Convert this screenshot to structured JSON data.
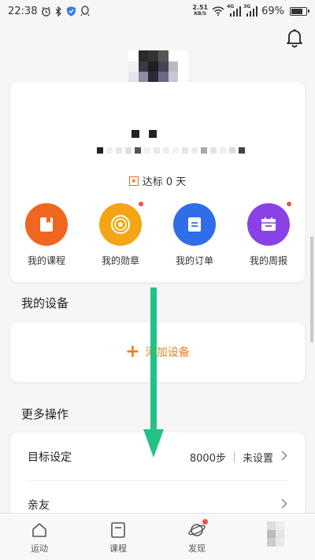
{
  "status_bar": {
    "time": "22:38",
    "net_speed_value": "2.51",
    "net_speed_unit": "KB/S",
    "battery": "69%",
    "signal_1": "4G",
    "signal_2": "3G"
  },
  "header": {
    "notification_icon": "bell-icon"
  },
  "profile": {
    "goal_badge": "★",
    "goal_text": "达标 0 天"
  },
  "quick_actions": [
    {
      "label": "我的课程",
      "color": "#f0661e",
      "icon": "book-icon",
      "dot": false
    },
    {
      "label": "我的勋章",
      "color": "#f4a515",
      "icon": "medal-icon",
      "dot": true
    },
    {
      "label": "我的订单",
      "color": "#2f6ee8",
      "icon": "document-icon",
      "dot": false
    },
    {
      "label": "我的周报",
      "color": "#8a42e6",
      "icon": "report-icon",
      "dot": true
    }
  ],
  "devices": {
    "title": "我的设备",
    "add_plus": "+",
    "add_label": "添加设备"
  },
  "more": {
    "title": "更多操作",
    "rows": [
      {
        "label": "目标设定",
        "value": "8000步",
        "status": "未设置"
      },
      {
        "label": "亲友"
      }
    ]
  },
  "bottom_nav": [
    {
      "label": "运动",
      "icon": "home-icon",
      "dot": false
    },
    {
      "label": "课程",
      "icon": "course-icon",
      "dot": false
    },
    {
      "label": "发现",
      "icon": "planet-icon",
      "dot": true
    },
    {
      "label": "",
      "icon": "avatar-icon",
      "dot": false
    }
  ],
  "colors": {
    "accent": "#f07c1b",
    "arrow": "#22c285"
  }
}
